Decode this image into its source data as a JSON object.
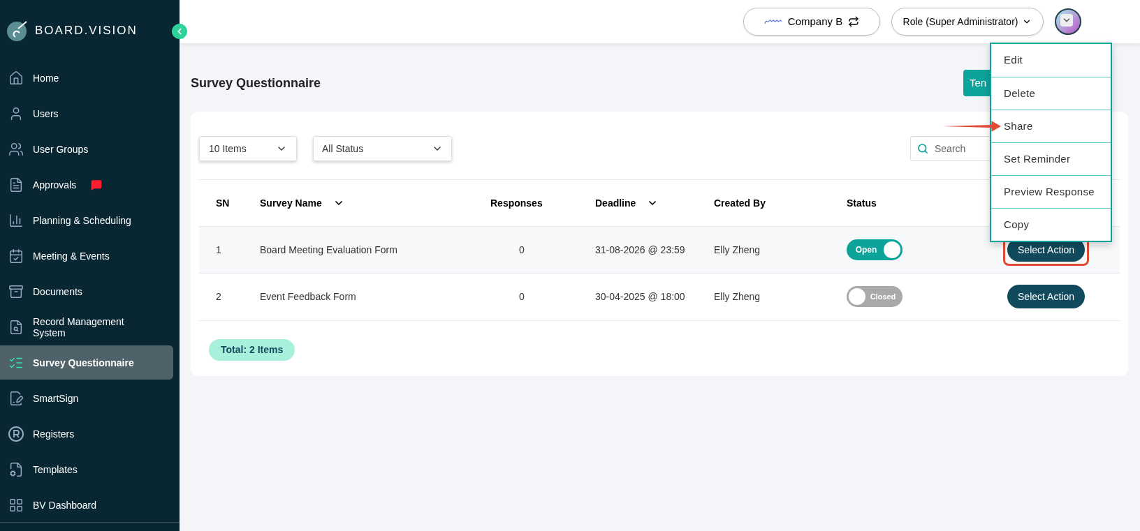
{
  "brand": {
    "name": "BOARD.VISION"
  },
  "sidebar": {
    "items": [
      {
        "label": "Home",
        "selected": false
      },
      {
        "label": "Users",
        "selected": false
      },
      {
        "label": "User Groups",
        "selected": false
      },
      {
        "label": "Approvals",
        "selected": false,
        "badge": true
      },
      {
        "label": "Planning & Scheduling",
        "selected": false
      },
      {
        "label": "Meeting & Events",
        "selected": false
      },
      {
        "label": "Documents",
        "selected": false
      },
      {
        "label": "Record Management System",
        "selected": false
      },
      {
        "label": "Survey Questionnaire",
        "selected": true
      },
      {
        "label": "SmartSign",
        "selected": false
      },
      {
        "label": "Registers",
        "selected": false
      },
      {
        "label": "Templates",
        "selected": false
      },
      {
        "label": "BV Dashboard",
        "selected": false
      }
    ]
  },
  "header": {
    "company": "Company B",
    "role": "Role (Super Administrator)"
  },
  "page": {
    "title": "Survey Questionnaire",
    "button": "Ten"
  },
  "filters": {
    "page_size": "10 Items",
    "status": "All Status",
    "search": {
      "placeholder": "Search"
    }
  },
  "table": {
    "columns": [
      {
        "label": "SN",
        "sortable": false
      },
      {
        "label": "Survey Name",
        "sortable": true
      },
      {
        "label": "Responses",
        "sortable": false
      },
      {
        "label": "Deadline",
        "sortable": true
      },
      {
        "label": "Created By",
        "sortable": false
      },
      {
        "label": "Status",
        "sortable": false
      }
    ],
    "rows": [
      {
        "sn": "1",
        "name": "Board Meeting Evaluation Form",
        "responses": "0",
        "deadline": "31-08-2026 @ 23:59",
        "created_by": "Elly Zheng",
        "status": {
          "label": "Open",
          "on": true
        },
        "action": "Select Action",
        "highlighted": true
      },
      {
        "sn": "2",
        "name": "Event Feedback Form",
        "responses": "0",
        "deadline": "30-04-2025 @ 18:00",
        "created_by": "Elly Zheng",
        "status": {
          "label": "Closed",
          "on": false
        },
        "action": "Select Action",
        "highlighted": false
      }
    ]
  },
  "total": "Total: 2 Items",
  "action_menu": {
    "items": [
      {
        "label": "Edit",
        "pointed": false
      },
      {
        "label": "Delete",
        "pointed": false
      },
      {
        "label": "Share",
        "pointed": true
      },
      {
        "label": "Set Reminder",
        "pointed": false
      },
      {
        "label": "Preview Response",
        "pointed": false
      },
      {
        "label": "Copy",
        "pointed": false
      }
    ]
  }
}
